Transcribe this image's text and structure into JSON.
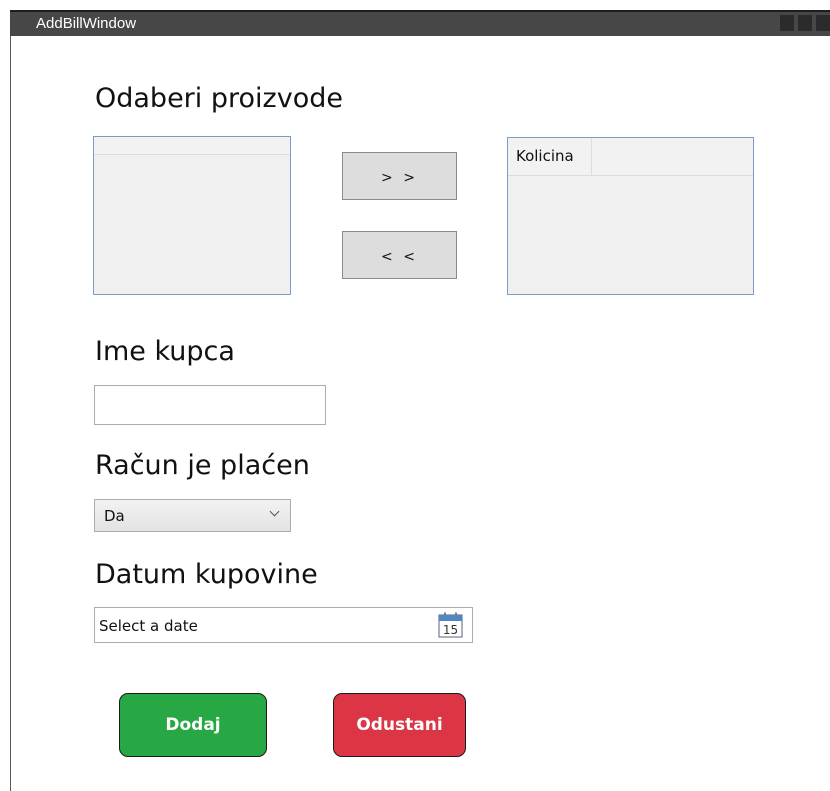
{
  "window": {
    "title": "AddBillWindow"
  },
  "products": {
    "heading": "Odaberi proizvode",
    "add_label": "> >",
    "remove_label": "< <",
    "selected_columns": [
      "Kolicina"
    ]
  },
  "customer": {
    "heading": "Ime kupca",
    "value": ""
  },
  "paid": {
    "heading": "Račun je plaćen",
    "selected": "Da"
  },
  "purchase_date": {
    "heading": "Datum kupovine",
    "placeholder": "Select a date",
    "calendar_day": "15"
  },
  "actions": {
    "add_label": "Dodaj",
    "cancel_label": "Odustani"
  },
  "colors": {
    "add_button": "#28a745",
    "cancel_button": "#dc3545",
    "titlebar": "#474747"
  }
}
